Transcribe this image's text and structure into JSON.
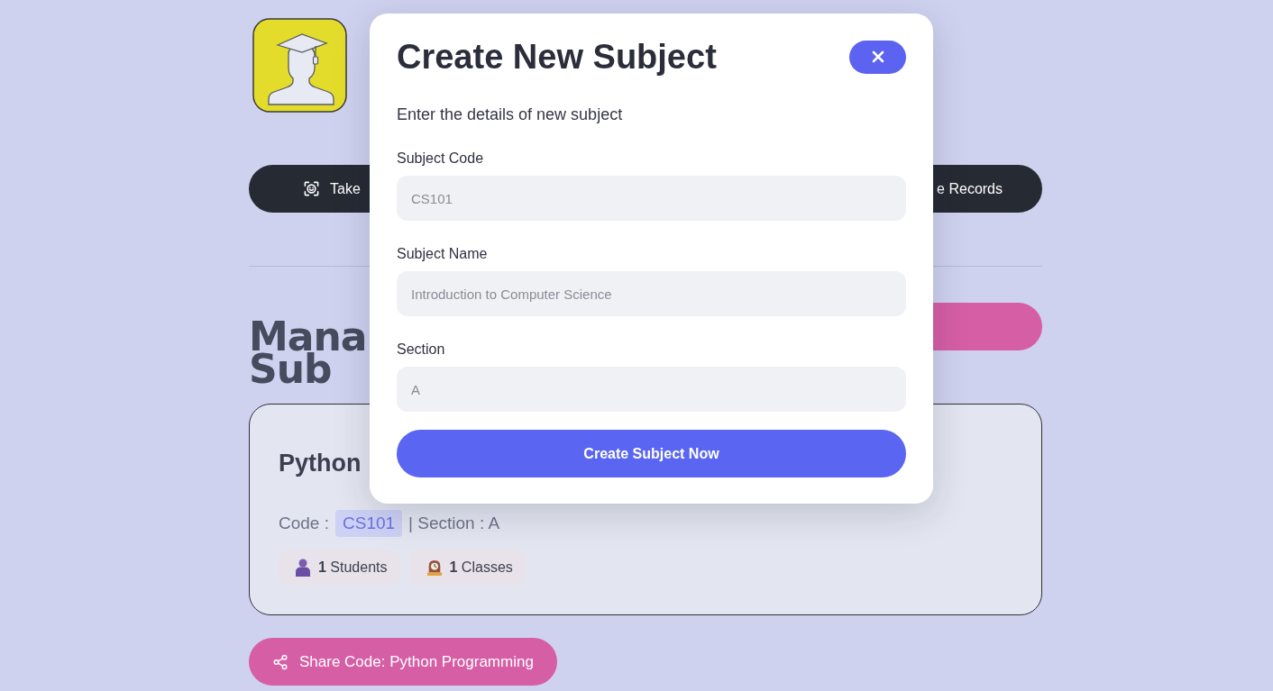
{
  "nav": {
    "items": [
      {
        "label": "Take"
      },
      {
        "label": "e Records"
      }
    ]
  },
  "heading": "Mana Sub",
  "subjects": [
    {
      "name": "Python",
      "code_label": "Code :",
      "code": "CS101",
      "section_label": "| Section : A",
      "stats": [
        {
          "kind": "students",
          "text": "**1** Students"
        },
        {
          "kind": "classes",
          "text": "**1** Classes"
        }
      ]
    }
  ],
  "share_button": "Share Code: Python Programming",
  "modal": {
    "title": "Create New Subject",
    "subtitle": "Enter the details of new subject",
    "fields": [
      {
        "label": "Subject Code",
        "placeholder": "CS101"
      },
      {
        "label": "Subject Name",
        "placeholder": "Introduction to Computer Science"
      },
      {
        "label": "Section",
        "placeholder": "A"
      }
    ],
    "submit": "Create Subject Now"
  }
}
